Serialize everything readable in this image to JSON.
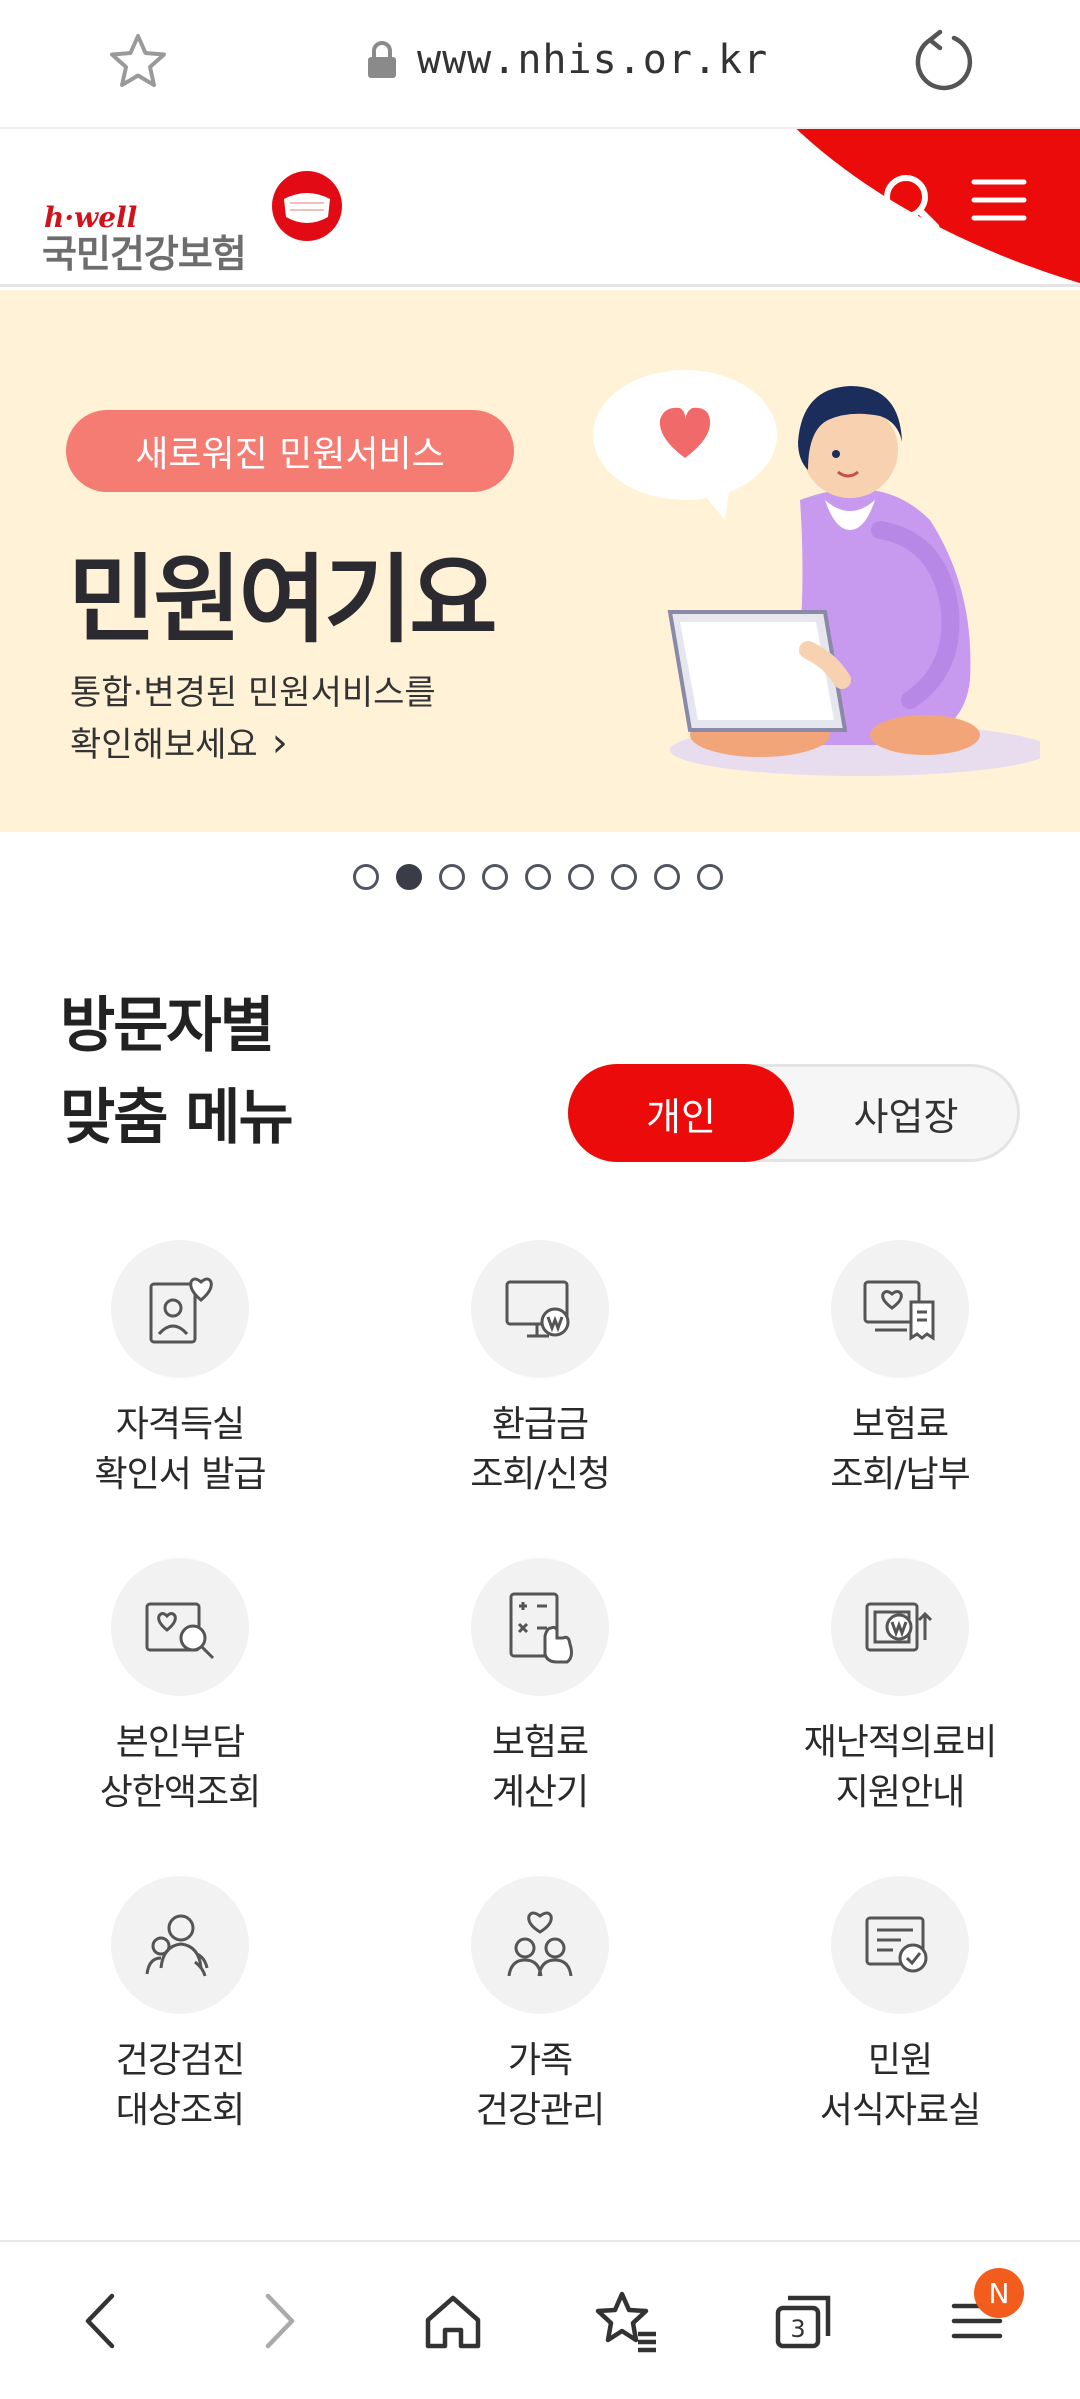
{
  "browser": {
    "url": "www.nhis.or.kr",
    "icons": [
      "star-icon",
      "lock-icon",
      "reload-icon"
    ]
  },
  "header": {
    "brand_script": "h·well",
    "brand_name": "국민건강보험",
    "accent_color": "#ec0b0b",
    "icons": [
      "search-icon",
      "hamburger-menu-icon"
    ]
  },
  "banner": {
    "pill_text": "새로워진 민원서비스",
    "title": "민원여기요",
    "subtitle_line1": "통합·변경된 민원서비스를",
    "subtitle_line2": "확인해보세요",
    "background": "#fff2d6",
    "slides_total": 9,
    "active_slide": 2
  },
  "visitor_menu": {
    "title_line1": "방문자별",
    "title_line2": "맞춤 메뉴",
    "toggle": {
      "personal": "개인",
      "business": "사업장",
      "selected": "개인"
    },
    "items": [
      {
        "line1": "자격득실",
        "line2": "확인서 발급",
        "icon": "id-card-heart-icon"
      },
      {
        "line1": "환급금",
        "line2": "조회/신청",
        "icon": "monitor-won-icon"
      },
      {
        "line1": "보험료",
        "line2": "조회/납부",
        "icon": "monitor-receipt-icon"
      },
      {
        "line1": "본인부담",
        "line2": "상한액조회",
        "icon": "heart-search-icon"
      },
      {
        "line1": "보험료",
        "line2": "계산기",
        "icon": "calculator-icon"
      },
      {
        "line1": "재난적의료비",
        "line2": "지원안내",
        "icon": "won-up-icon"
      },
      {
        "line1": "건강검진",
        "line2": "대상조회",
        "icon": "people-check-icon"
      },
      {
        "line1": "가족",
        "line2": "건강관리",
        "icon": "family-heart-icon"
      },
      {
        "line1": "민원",
        "line2": "서식자료실",
        "icon": "document-check-icon"
      }
    ]
  },
  "bottom_nav": {
    "icons": [
      "back-icon",
      "forward-icon",
      "home-icon",
      "bookmarks-icon",
      "tabs-icon",
      "menu-icon"
    ],
    "tabs_count": "3",
    "menu_badge": "N"
  }
}
